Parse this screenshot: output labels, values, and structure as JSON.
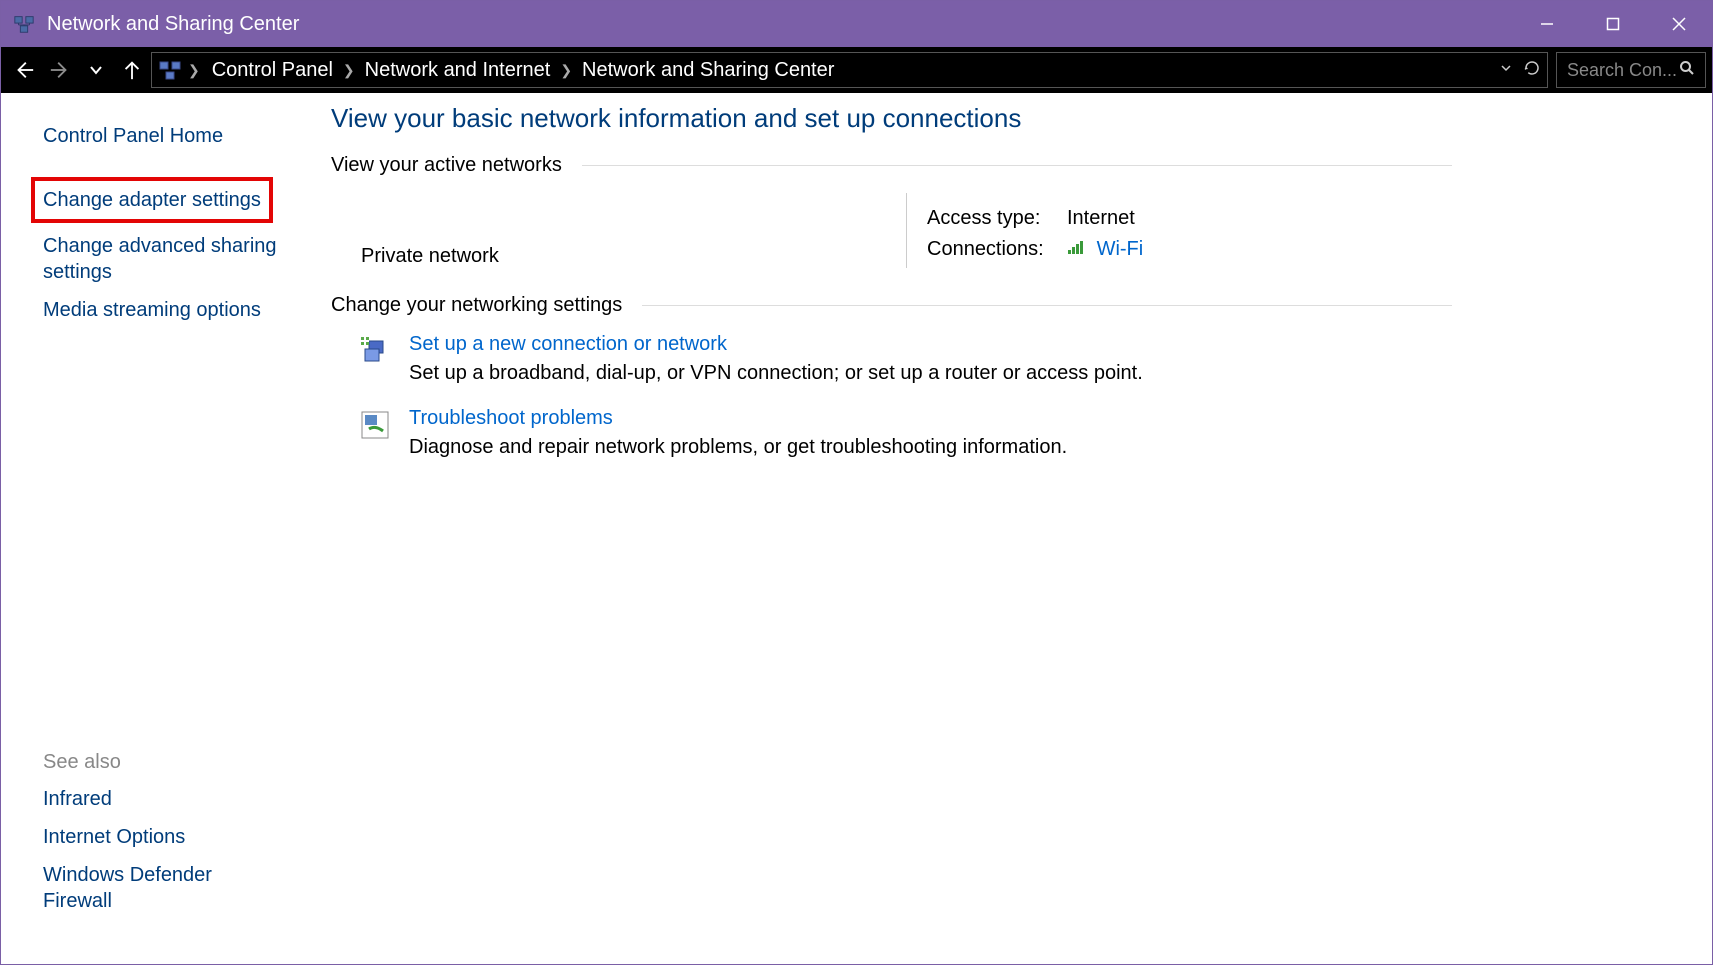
{
  "titlebar": {
    "title": "Network and Sharing Center"
  },
  "breadcrumb": {
    "items": [
      "Control Panel",
      "Network and Internet",
      "Network and Sharing Center"
    ]
  },
  "search": {
    "placeholder": "Search Con..."
  },
  "sidebar": {
    "home": "Control Panel Home",
    "links": [
      "Change adapter settings",
      "Change advanced sharing settings",
      "Media streaming options"
    ],
    "see_also_label": "See also",
    "see_also": [
      "Infrared",
      "Internet Options",
      "Windows Defender Firewall"
    ]
  },
  "main": {
    "title": "View your basic network information and set up connections",
    "active_networks_label": "View your active networks",
    "network": {
      "type": "Private network",
      "access_type_label": "Access type:",
      "access_type_value": "Internet",
      "connections_label": "Connections:",
      "connection_name": "Wi-Fi"
    },
    "change_settings_label": "Change your networking settings",
    "tasks": [
      {
        "title": "Set up a new connection or network",
        "desc": "Set up a broadband, dial-up, or VPN connection; or set up a router or access point."
      },
      {
        "title": "Troubleshoot problems",
        "desc": "Diagnose and repair network problems, or get troubleshooting information."
      }
    ]
  },
  "highlight_index": 0
}
